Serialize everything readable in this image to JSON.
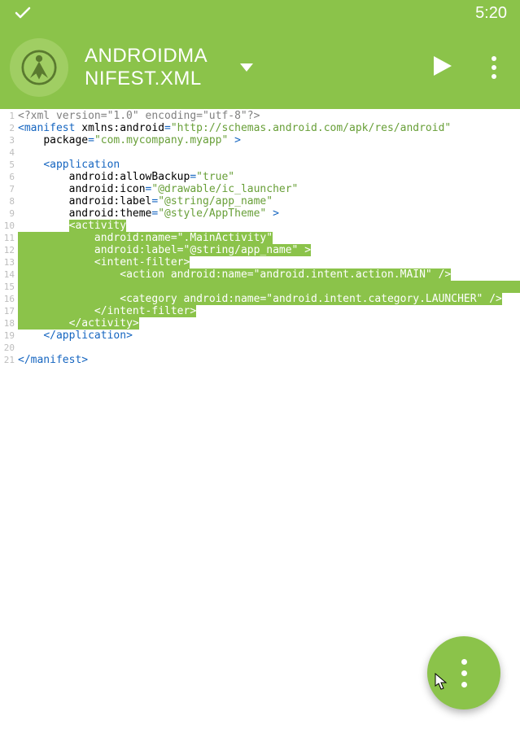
{
  "statusbar": {
    "time": "5:20"
  },
  "header": {
    "title_line1": "ANDROIDMA",
    "title_line2": "NIFEST.XML"
  },
  "code": {
    "lines": [
      {
        "n": 1,
        "sel": "none",
        "tokens": [
          [
            "pi",
            "<?xml version=\"1.0\" encoding=\"utf-8\"?>"
          ]
        ]
      },
      {
        "n": 2,
        "sel": "none",
        "tokens": [
          [
            "punct",
            "<"
          ],
          [
            "tag",
            "manifest"
          ],
          [
            "txt",
            " "
          ],
          [
            "attr",
            "xmlns:android"
          ],
          [
            "punct",
            "="
          ],
          [
            "str",
            "\"http://schemas.android.com/apk/res/android\""
          ]
        ]
      },
      {
        "n": 3,
        "sel": "none",
        "tokens": [
          [
            "txt",
            "    "
          ],
          [
            "attr",
            "package"
          ],
          [
            "punct",
            "="
          ],
          [
            "str",
            "\"com.mycompany.myapp\""
          ],
          [
            "txt",
            " "
          ],
          [
            "punct",
            ">"
          ]
        ]
      },
      {
        "n": 4,
        "sel": "none",
        "tokens": []
      },
      {
        "n": 5,
        "sel": "none",
        "tokens": [
          [
            "txt",
            "    "
          ],
          [
            "punct",
            "<"
          ],
          [
            "tag",
            "application"
          ]
        ]
      },
      {
        "n": 6,
        "sel": "none",
        "tokens": [
          [
            "txt",
            "        "
          ],
          [
            "attr",
            "android:allowBackup"
          ],
          [
            "punct",
            "="
          ],
          [
            "str",
            "\"true\""
          ]
        ]
      },
      {
        "n": 7,
        "sel": "none",
        "tokens": [
          [
            "txt",
            "        "
          ],
          [
            "attr",
            "android:icon"
          ],
          [
            "punct",
            "="
          ],
          [
            "str",
            "\"@drawable/ic_launcher\""
          ]
        ]
      },
      {
        "n": 8,
        "sel": "none",
        "tokens": [
          [
            "txt",
            "        "
          ],
          [
            "attr",
            "android:label"
          ],
          [
            "punct",
            "="
          ],
          [
            "str",
            "\"@string/app_name\""
          ]
        ]
      },
      {
        "n": 9,
        "sel": "none",
        "tokens": [
          [
            "txt",
            "        "
          ],
          [
            "attr",
            "android:theme"
          ],
          [
            "punct",
            "="
          ],
          [
            "str",
            "\"@style/AppTheme\""
          ],
          [
            "txt",
            " "
          ],
          [
            "punct",
            ">"
          ]
        ]
      },
      {
        "n": 10,
        "sel": "partial",
        "pre": "        ",
        "seltokens": [
          [
            "punct",
            "<"
          ],
          [
            "tag",
            "activity"
          ]
        ]
      },
      {
        "n": 11,
        "sel": "full",
        "seltokens": [
          [
            "txt",
            "            "
          ],
          [
            "attr",
            "android:name"
          ],
          [
            "punct",
            "="
          ],
          [
            "str",
            "\".MainActivity\""
          ]
        ]
      },
      {
        "n": 12,
        "sel": "full",
        "seltokens": [
          [
            "txt",
            "            "
          ],
          [
            "attr",
            "android:label"
          ],
          [
            "punct",
            "="
          ],
          [
            "str",
            "\"@string/app_name\""
          ],
          [
            "txt",
            " "
          ],
          [
            "punct",
            ">"
          ]
        ]
      },
      {
        "n": 13,
        "sel": "full",
        "seltokens": [
          [
            "txt",
            "            "
          ],
          [
            "punct",
            "<"
          ],
          [
            "tag",
            "intent-filter"
          ],
          [
            "punct",
            ">"
          ]
        ]
      },
      {
        "n": 14,
        "sel": "full",
        "seltokens": [
          [
            "txt",
            "                "
          ],
          [
            "punct",
            "<"
          ],
          [
            "tag",
            "action"
          ],
          [
            "txt",
            " "
          ],
          [
            "attr",
            "android:name"
          ],
          [
            "punct",
            "="
          ],
          [
            "str",
            "\"android.intent.action.MAIN\""
          ],
          [
            "txt",
            " "
          ],
          [
            "punct",
            "/>"
          ]
        ]
      },
      {
        "n": 15,
        "sel": "cursor",
        "tokens": []
      },
      {
        "n": 16,
        "sel": "full",
        "seltokens": [
          [
            "txt",
            "                "
          ],
          [
            "punct",
            "<"
          ],
          [
            "tag",
            "category"
          ],
          [
            "txt",
            " "
          ],
          [
            "attr",
            "android:name"
          ],
          [
            "punct",
            "="
          ],
          [
            "str",
            "\"android.intent.category.LAUNCHER\""
          ],
          [
            "txt",
            " "
          ],
          [
            "punct",
            "/>"
          ]
        ]
      },
      {
        "n": 17,
        "sel": "full",
        "seltokens": [
          [
            "txt",
            "            "
          ],
          [
            "punct",
            "</"
          ],
          [
            "tag",
            "intent-filter"
          ],
          [
            "punct",
            ">"
          ]
        ]
      },
      {
        "n": 18,
        "sel": "full",
        "seltokens": [
          [
            "txt",
            "        "
          ],
          [
            "punct",
            "</"
          ],
          [
            "tag",
            "activity"
          ],
          [
            "punct",
            ">"
          ]
        ]
      },
      {
        "n": 19,
        "sel": "none",
        "tokens": [
          [
            "txt",
            "    "
          ],
          [
            "punct",
            "</"
          ],
          [
            "tag",
            "application"
          ],
          [
            "punct",
            ">"
          ]
        ]
      },
      {
        "n": 20,
        "sel": "none",
        "tokens": []
      },
      {
        "n": 21,
        "sel": "none",
        "tokens": [
          [
            "punct",
            "</"
          ],
          [
            "tag",
            "manifest"
          ],
          [
            "punct",
            ">"
          ]
        ]
      }
    ]
  }
}
